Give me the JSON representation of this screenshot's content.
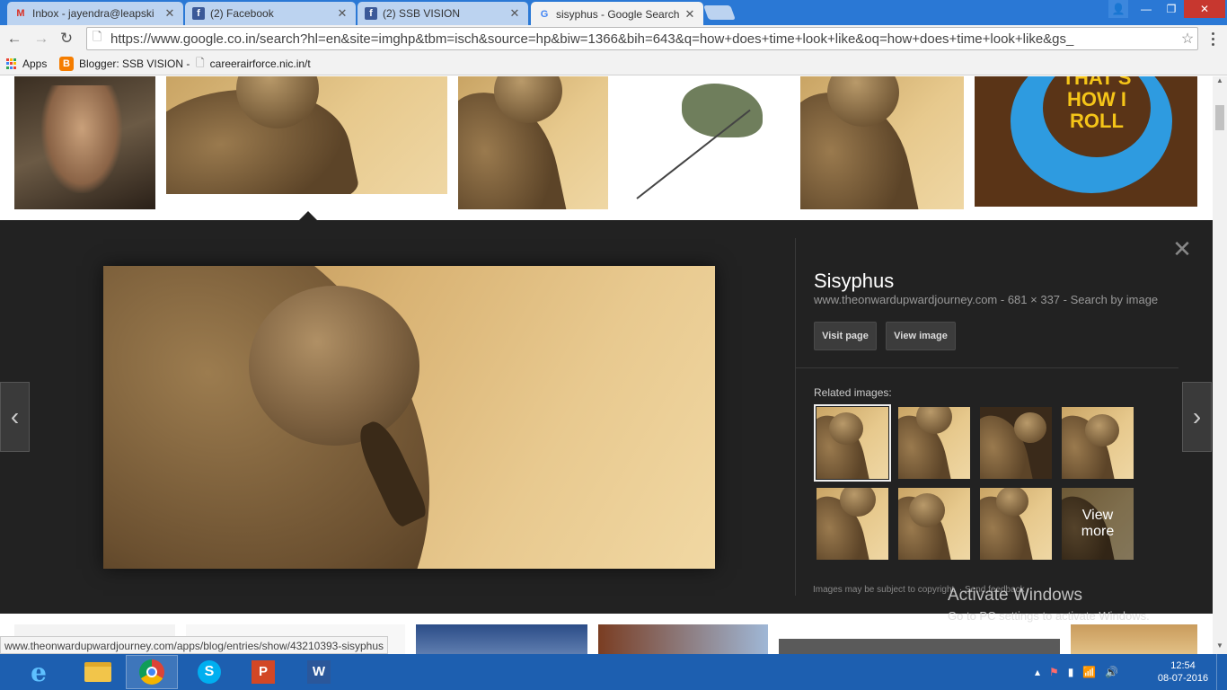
{
  "tabs": [
    {
      "title": "Inbox - jayendra@leapski",
      "icon": "gmail-icon",
      "active": false
    },
    {
      "title": "(2) Facebook",
      "icon": "facebook-icon",
      "active": false
    },
    {
      "title": "(2) SSB VISION",
      "icon": "facebook-icon",
      "active": false
    },
    {
      "title": "sisyphus - Google Search",
      "icon": "google-icon",
      "active": true
    }
  ],
  "address_bar": {
    "url": "https://www.google.co.in/search?hl=en&site=imghp&tbm=isch&source=hp&biw=1366&bih=643&q=how+does+time+look+like&oq=how+does+time+look+like&gs_"
  },
  "bookmarks": {
    "apps": "Apps",
    "items": [
      "Blogger: SSB VISION -",
      "careerairforce.nic.in/t"
    ]
  },
  "image_results_top": [
    "Sisyphus painting",
    "Sisyphus sepia",
    "Sisyphus sepia",
    "Sisyphus drawing",
    "Sisyphus sepia",
    "That's how I roll"
  ],
  "roll_art_text": "THAT'S\nHOW I\nROLL",
  "preview": {
    "title": "Sisyphus",
    "source": "www.theonwardupwardjourney.com",
    "dimensions": "681 × 337",
    "search_by_image": "Search by image",
    "visit_page": "Visit page",
    "view_image": "View image",
    "related_label": "Related images:",
    "view_more_line1": "View",
    "view_more_line2": "more",
    "disclaimer": "Images may be subject to copyright. · Send feedback"
  },
  "watermark": {
    "line1": "Activate Windows",
    "line2": "Go to PC settings to activate Windows."
  },
  "status_url": "www.theonwardupwardjourney.com/apps/blog/entries/show/43210393-sisyphus",
  "taskbar": {
    "apps": [
      "ie-icon",
      "file-explorer-icon",
      "chrome-icon",
      "skype-icon",
      "powerpoint-icon",
      "word-icon"
    ],
    "time": "12:54",
    "date": "08-07-2016"
  },
  "colors": {
    "titlebar": "#2a78d5",
    "taskbar": "#1d5fb0",
    "preview_bg": "#222222"
  }
}
